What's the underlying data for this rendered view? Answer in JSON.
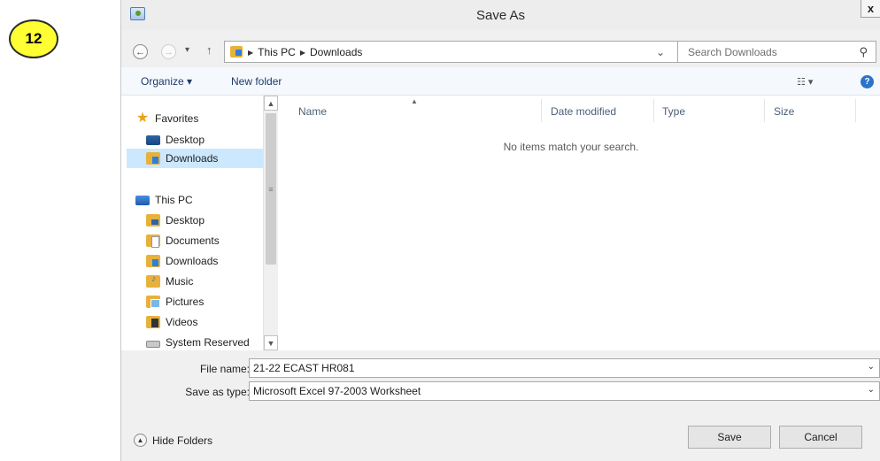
{
  "step_badge": "12",
  "dialog": {
    "title": "Save As",
    "close_label": "x"
  },
  "nav": {
    "back_glyph": "←",
    "forward_glyph": "→",
    "recent_glyph": "▾",
    "up_glyph": "↑"
  },
  "address": {
    "crumbs": [
      "This PC",
      "Downloads"
    ],
    "sep_glyph": "▶",
    "dropdown_glyph": "⌄",
    "refresh_glyph": "↻"
  },
  "search": {
    "placeholder": "Search Downloads",
    "icon_glyph": "⚲"
  },
  "toolbar": {
    "organize": "Organize ▾",
    "new_folder": "New folder",
    "view_glyph": "☷ ▾",
    "help_glyph": "?"
  },
  "sidebar": {
    "favorites": "Favorites",
    "fav_items": [
      "Desktop",
      "Downloads"
    ],
    "this_pc": "This PC",
    "pc_items": [
      "Desktop",
      "Documents",
      "Downloads",
      "Music",
      "Pictures",
      "Videos",
      "System Reserved"
    ],
    "selected": "Downloads"
  },
  "scrollbar": {
    "up_glyph": "▲",
    "down_glyph": "▼",
    "grip_glyph": "≡"
  },
  "file_list": {
    "columns": [
      "Name",
      "Date modified",
      "Type",
      "Size"
    ],
    "sort_glyph": "▲",
    "empty_message": "No items match your search."
  },
  "fields": {
    "file_name_label": "File name:",
    "file_name_value": "21-22 ECAST HR081",
    "save_type_label": "Save as type:",
    "save_type_value": "Microsoft Excel 97-2003 Worksheet",
    "chevron_glyph": "⌄"
  },
  "footer": {
    "hide_folders": "Hide Folders",
    "hide_glyph": "▲",
    "save": "Save",
    "cancel": "Cancel"
  },
  "colors": {
    "badge": "#ffff33",
    "selected_row": "#cce8ff",
    "toolbar_bg": "#f5f9fd",
    "folder": "#e8b13b"
  }
}
